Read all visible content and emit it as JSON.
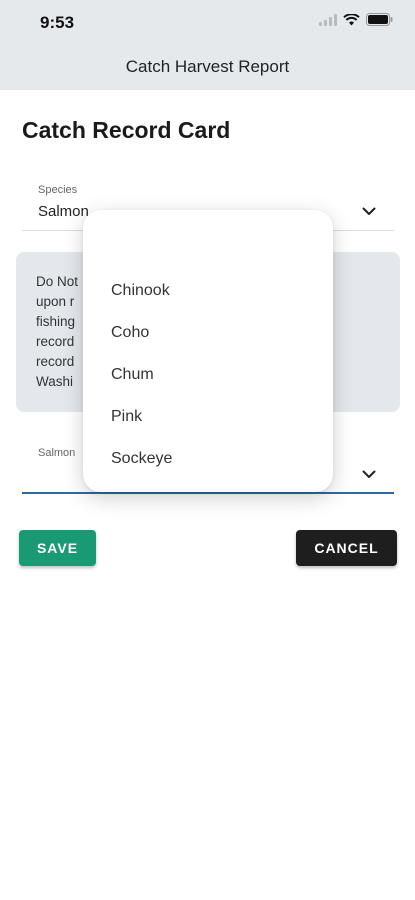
{
  "status_bar": {
    "time": "9:53"
  },
  "nav": {
    "title": "Catch Harvest Report"
  },
  "page": {
    "title": "Catch Record Card"
  },
  "species_field": {
    "label": "Species",
    "value": "Salmon"
  },
  "notice": {
    "lines": [
      "Do Not",
      "upon r",
      "fishing",
      "record",
      "record",
      "Washi"
    ]
  },
  "salmon_field": {
    "label": "Salmon",
    "value": ""
  },
  "buttons": {
    "save": "SAVE",
    "cancel": "CANCEL"
  },
  "dropdown": {
    "options": [
      "Chinook",
      "Coho",
      "Chum",
      "Pink",
      "Sockeye"
    ]
  },
  "colors": {
    "save": "#1a9a74",
    "cancel": "#1e1e1e",
    "active_underline": "#2d6aa3"
  }
}
